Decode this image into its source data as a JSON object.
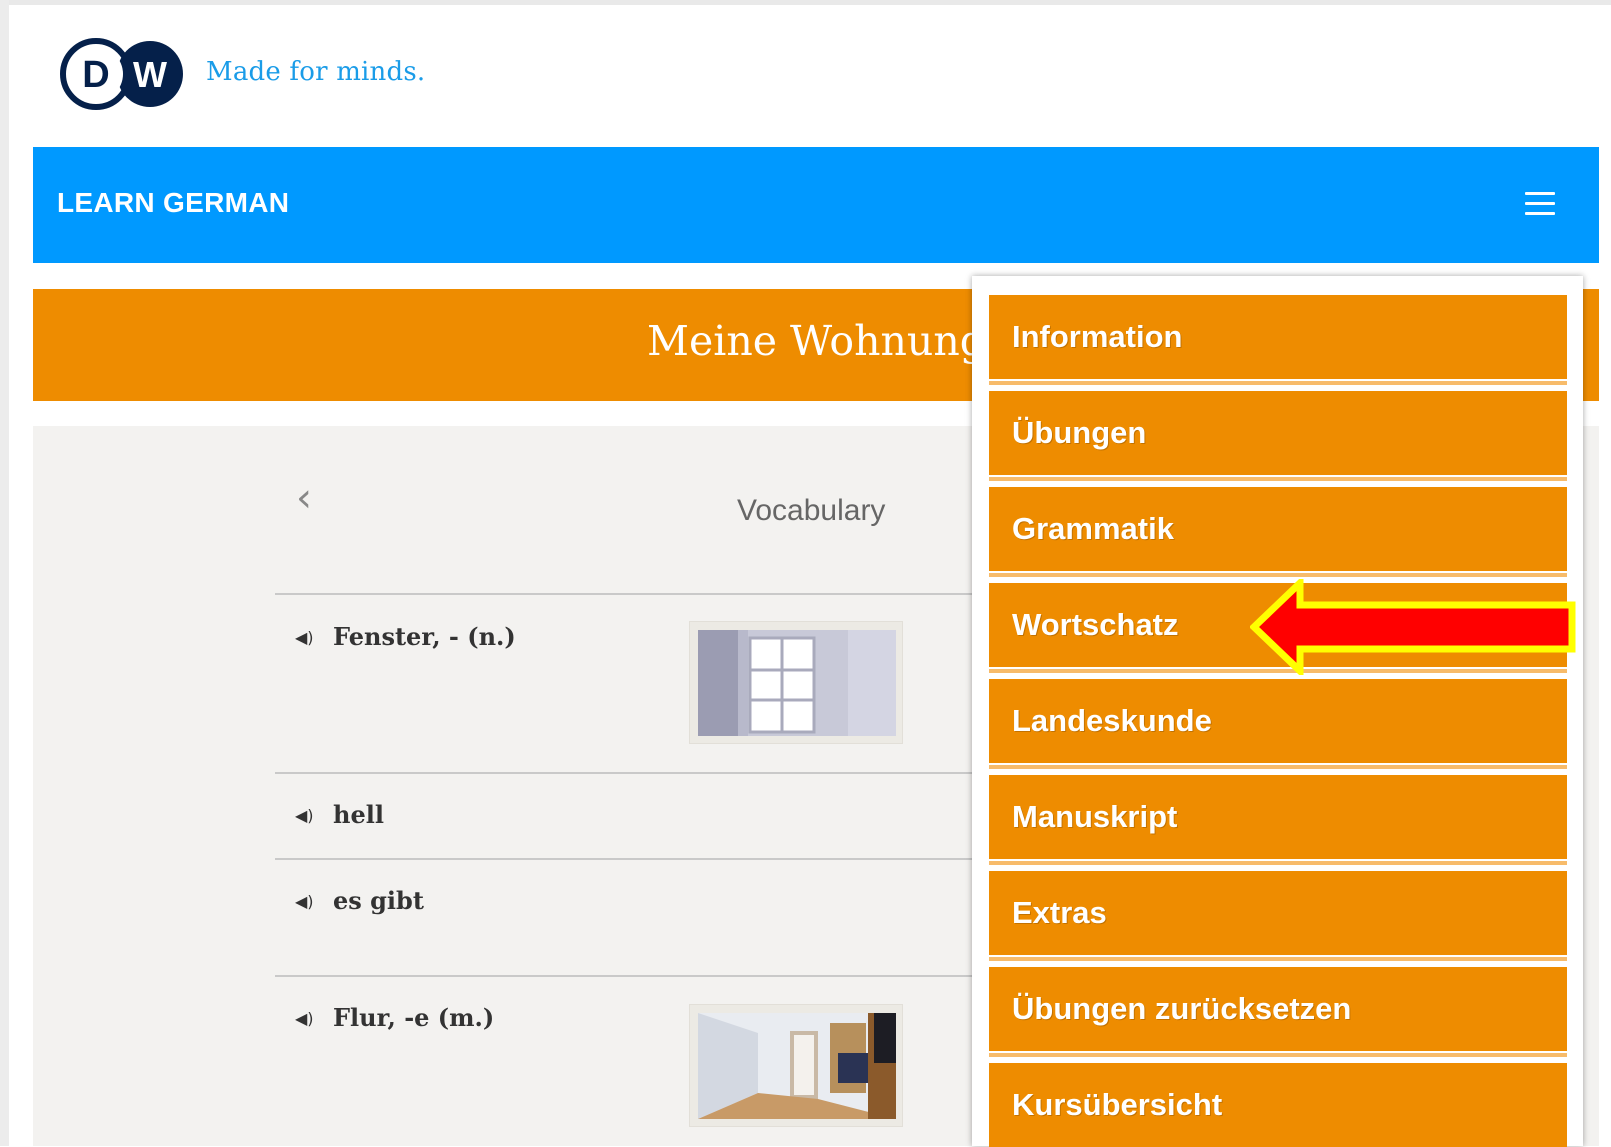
{
  "header": {
    "tagline": "Made for minds.",
    "logo_letters": "DW"
  },
  "nav": {
    "title": "LEARN GERMAN",
    "menu_icon": "hamburger-icon"
  },
  "lesson": {
    "title": "Meine Wohnung"
  },
  "content": {
    "back_icon": "chevron-left-icon",
    "section_title": "Vocabulary",
    "items": [
      {
        "word": "Fenster, - (n.)",
        "has_image": true
      },
      {
        "word": "hell",
        "has_image": false
      },
      {
        "word": "es gibt",
        "has_image": false
      },
      {
        "word": "Flur, -e (m.)",
        "has_image": true
      }
    ]
  },
  "menu": {
    "items": [
      {
        "label": "Information"
      },
      {
        "label": "Übungen"
      },
      {
        "label": "Grammatik"
      },
      {
        "label": "Wortschatz",
        "highlighted": true
      },
      {
        "label": "Landeskunde"
      },
      {
        "label": "Manuskript"
      },
      {
        "label": "Extras"
      },
      {
        "label": "Übungen zurücksetzen"
      },
      {
        "label": "Kursübersicht"
      }
    ]
  },
  "colors": {
    "brand_blue": "#0099ff",
    "dw_navy": "#05204a",
    "accent_orange": "#ee8c00",
    "annotation_arrow_fill": "#ff0000",
    "annotation_arrow_outline": "#ffff00"
  }
}
